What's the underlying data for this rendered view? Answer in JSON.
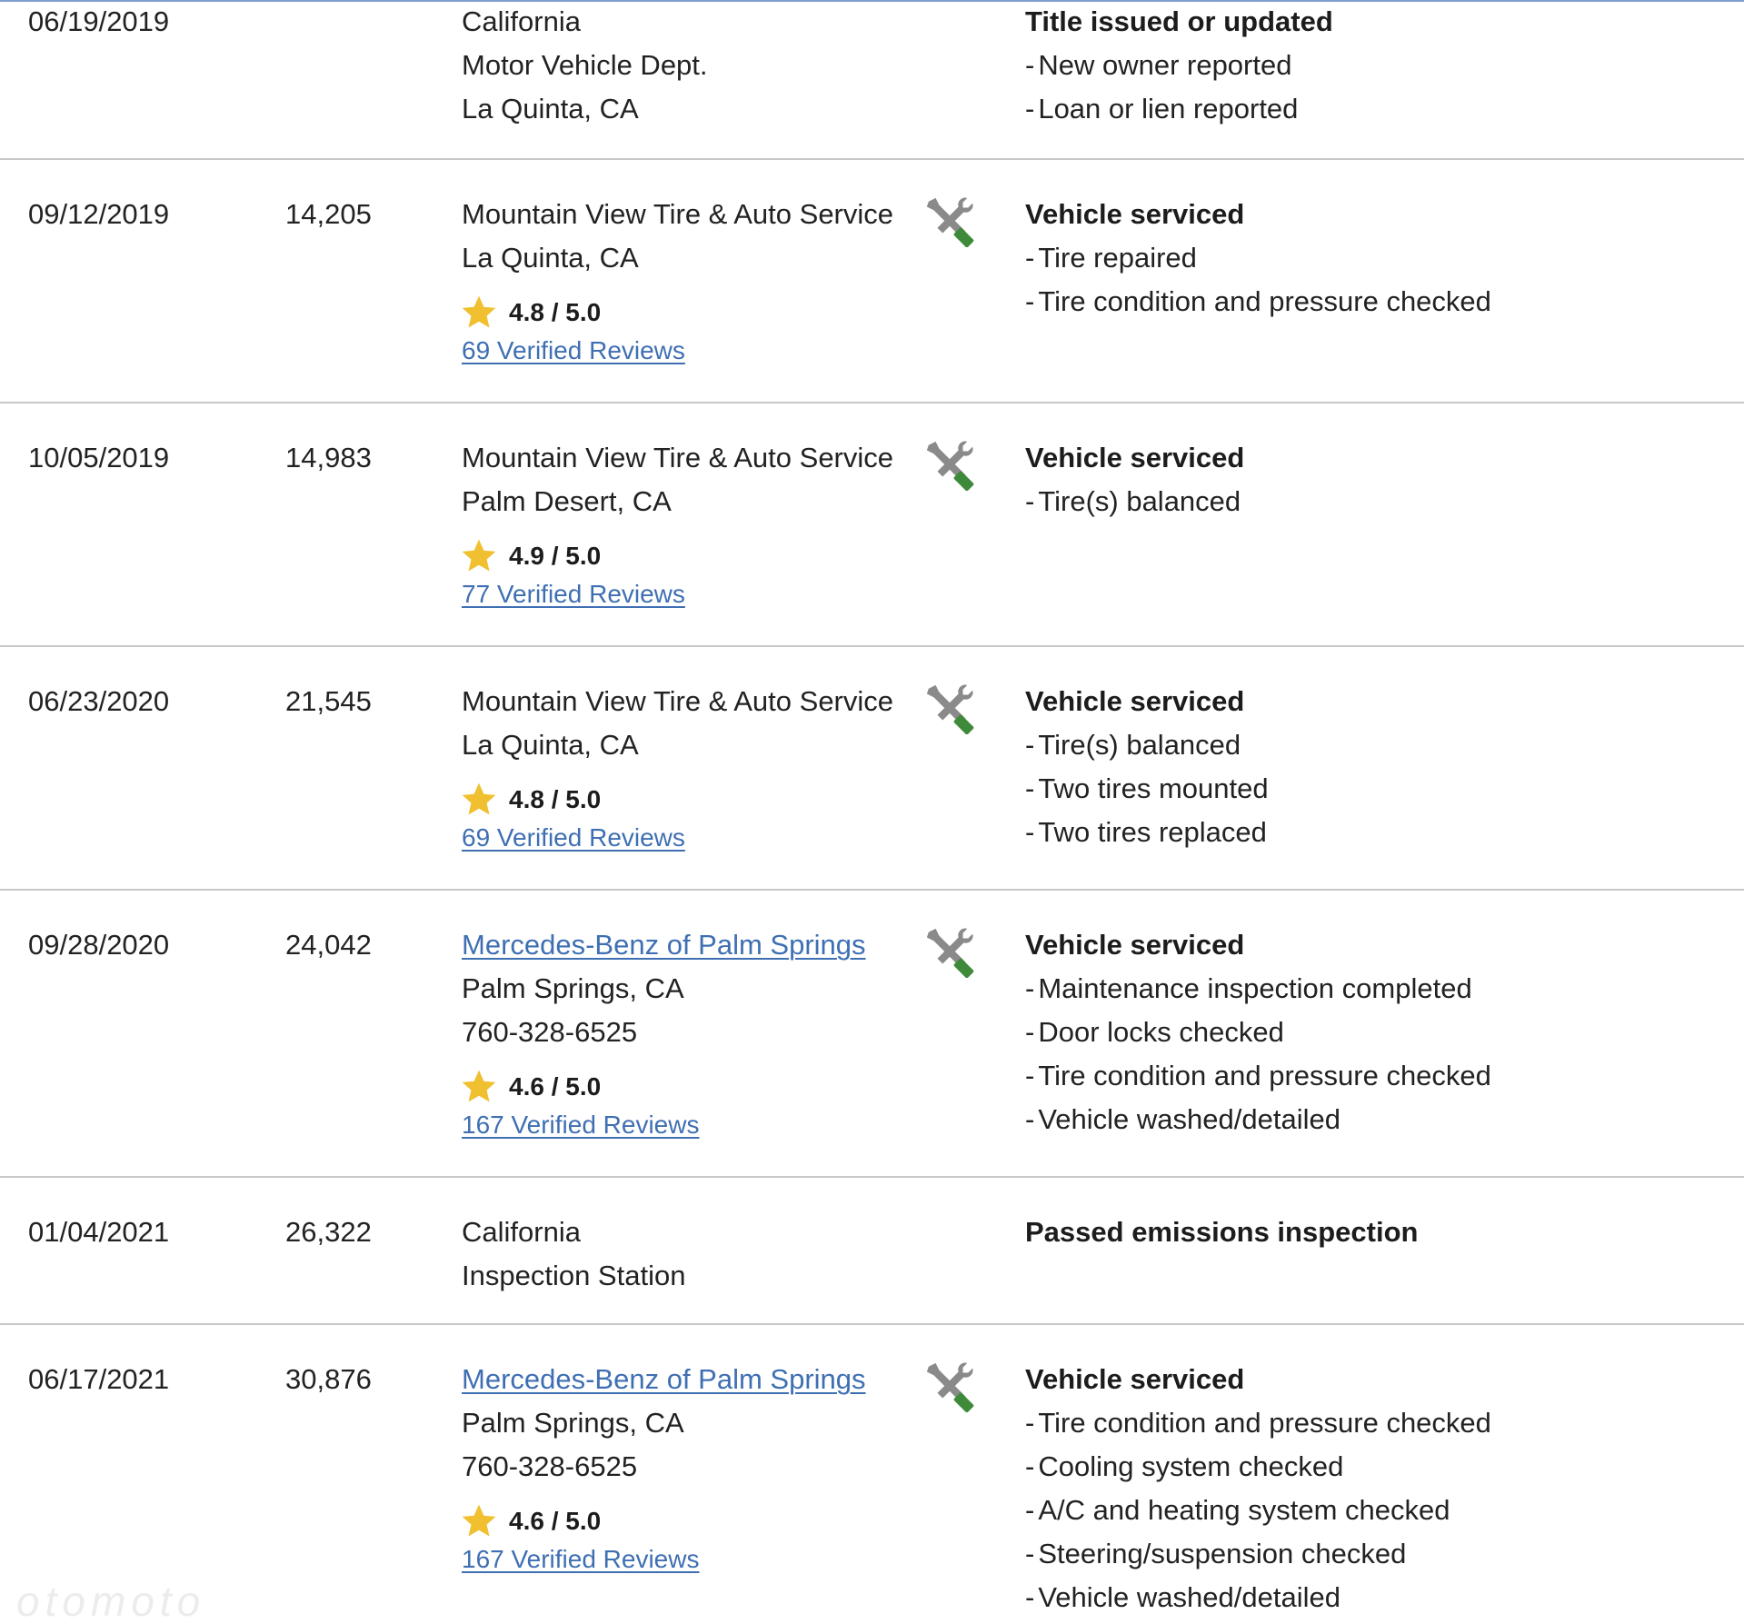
{
  "colors": {
    "link": "#3f6fb3",
    "star": "#f0c030",
    "tool_gray": "#8a8a8a",
    "tool_green": "#3f8a3a",
    "divider": "#c8c8c8"
  },
  "records": [
    {
      "date": "06/19/2019",
      "mileage": "",
      "source_lines": [
        "California",
        "Motor Vehicle Dept.",
        "La Quinta, CA"
      ],
      "headline": "Title issued or updated",
      "comments": [
        "New owner reported",
        "Loan or lien reported"
      ]
    },
    {
      "date": "09/12/2019",
      "mileage": "14,205",
      "source_lines": [
        "Mountain View Tire & Auto Service",
        "La Quinta, CA"
      ],
      "icon": "service-tools-icon",
      "rating": "4.8 / 5.0",
      "reviews": "69 Verified Reviews",
      "headline": "Vehicle serviced",
      "comments": [
        "Tire repaired",
        "Tire condition and pressure checked"
      ]
    },
    {
      "date": "10/05/2019",
      "mileage": "14,983",
      "source_lines": [
        "Mountain View Tire & Auto Service",
        "Palm Desert, CA"
      ],
      "icon": "service-tools-icon",
      "rating": "4.9 / 5.0",
      "reviews": "77 Verified Reviews",
      "headline": "Vehicle serviced",
      "comments": [
        "Tire(s) balanced"
      ]
    },
    {
      "date": "06/23/2020",
      "mileage": "21,545",
      "source_lines": [
        "Mountain View Tire & Auto Service",
        "La Quinta, CA"
      ],
      "icon": "service-tools-icon",
      "rating": "4.8 / 5.0",
      "reviews": "69 Verified Reviews",
      "headline": "Vehicle serviced",
      "comments": [
        "Tire(s) balanced",
        "Two tires mounted",
        "Two tires replaced"
      ]
    },
    {
      "date": "09/28/2020",
      "mileage": "24,042",
      "source_link": "Mercedes-Benz of Palm Springs",
      "source_lines": [
        "Palm Springs, CA",
        "760-328-6525"
      ],
      "icon": "service-tools-icon",
      "rating": "4.6 / 5.0",
      "reviews": "167 Verified Reviews",
      "headline": "Vehicle serviced",
      "comments": [
        "Maintenance inspection completed",
        "Door locks checked",
        "Tire condition and pressure checked",
        "Vehicle washed/detailed"
      ]
    },
    {
      "date": "01/04/2021",
      "mileage": "26,322",
      "source_lines": [
        "California",
        "Inspection Station"
      ],
      "headline": "Passed emissions inspection",
      "comments": []
    },
    {
      "date": "06/17/2021",
      "mileage": "30,876",
      "source_link": "Mercedes-Benz of Palm Springs",
      "source_lines": [
        "Palm Springs, CA",
        "760-328-6525"
      ],
      "icon": "service-tools-icon",
      "rating": "4.6 / 5.0",
      "reviews": "167 Verified Reviews",
      "headline": "Vehicle serviced",
      "comments": [
        "Tire condition and pressure checked",
        "Cooling system checked",
        "A/C and heating system checked",
        "Steering/suspension checked",
        "Vehicle washed/detailed"
      ]
    }
  ],
  "watermark": "otomoto"
}
